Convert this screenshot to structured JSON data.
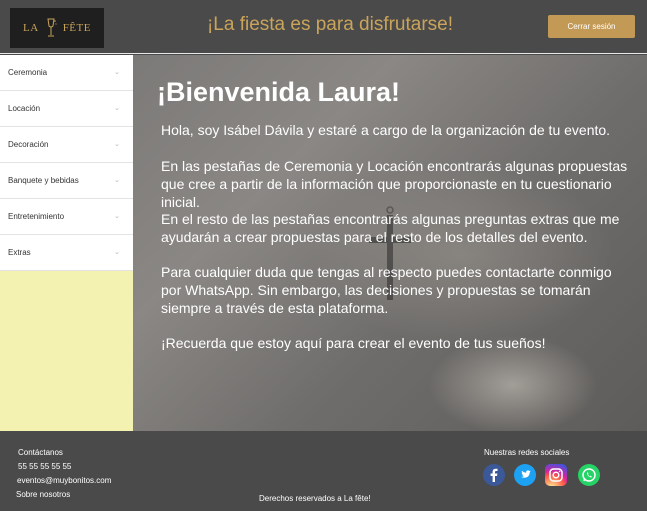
{
  "header": {
    "logo_text_left": "LA",
    "logo_text_right": "FÊTE",
    "tagline": "¡La fiesta es para disfrutarse!",
    "logout_label": "Cerrar sesión"
  },
  "sidebar": {
    "items": [
      {
        "label": "Ceremonia"
      },
      {
        "label": "Locación"
      },
      {
        "label": "Decoración"
      },
      {
        "label": "Banquete y bebidas"
      },
      {
        "label": "Entretenimiento"
      },
      {
        "label": "Extras"
      }
    ]
  },
  "main": {
    "welcome": "¡Bienvenida Laura!",
    "paragraphs": [
      "Hola, soy  Isábel Dávila y estaré a cargo de la organización de tu evento.",
      "En las pestañas de Ceremonia y Locación encontrarás algunas propuestas que cree a partir de la información que proporcionaste en tu cuestionario inicial.",
      "En el resto de las pestañas encontrarás algunas preguntas extras que me ayudarán a crear propuestas para el resto de los detalles del evento.",
      " Para cualquier duda que tengas al respecto puedes contactarte conmigo por WhatsApp. Sin embargo, las decisiones y propuestas se tomarán siempre a través de esta plataforma.",
      "¡Recuerda que estoy aquí para crear el evento de tus sueños!"
    ]
  },
  "footer": {
    "contact_title": "Contáctanos",
    "phone": "55 55 55 55 55",
    "email": "eventos@muybonitos.com",
    "about": "Sobre nosotros",
    "rights": "Derechos reservados a La fête!",
    "social_title": "Nuestras redes sociales",
    "social_icons": [
      "facebook-icon",
      "twitter-icon",
      "instagram-icon",
      "whatsapp-icon"
    ]
  },
  "colors": {
    "accent": "#c39a55",
    "tagline": "#c9a45a",
    "header_bg": "#4a4a4a",
    "sidebar_bg": "#f4f2b0"
  }
}
